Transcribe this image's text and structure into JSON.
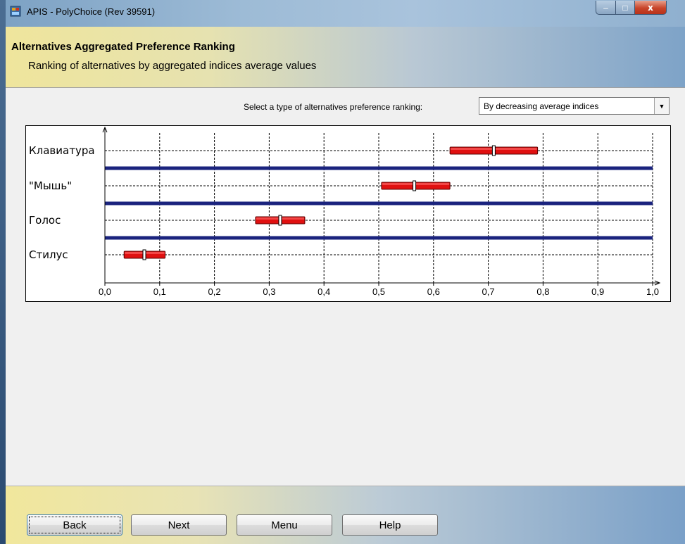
{
  "window": {
    "title": "APIS - PolyChoice (Rev 39591)",
    "controls": {
      "minimize": "–",
      "maximize": "□",
      "close": "x"
    }
  },
  "header": {
    "title": "Alternatives Aggregated Preference Ranking",
    "subtitle": "Ranking of alternatives by aggregated indices average values"
  },
  "ranking": {
    "label": "Select a type of alternatives preference ranking:",
    "selected": "By decreasing average indices"
  },
  "chart_data": {
    "type": "interval",
    "categories": [
      "Клавиатура",
      "\"Мышь\"",
      "Голос",
      "Стилус"
    ],
    "intervals": [
      {
        "low": 0.63,
        "mean": 0.71,
        "high": 0.79
      },
      {
        "low": 0.505,
        "mean": 0.565,
        "high": 0.63
      },
      {
        "low": 0.275,
        "mean": 0.32,
        "high": 0.365
      },
      {
        "low": 0.035,
        "mean": 0.072,
        "high": 0.11
      }
    ],
    "x_ticks": [
      "0,0",
      "0,1",
      "0,2",
      "0,3",
      "0,4",
      "0,5",
      "0,6",
      "0,7",
      "0,8",
      "0,9",
      "1,0"
    ],
    "xlim": [
      0,
      1
    ],
    "grid": true,
    "separators": true,
    "colors": {
      "bar": "#e01010",
      "separator": "#1a237e",
      "grid": "#000000"
    }
  },
  "footer": {
    "back": "Back",
    "next": "Next",
    "menu": "Menu",
    "help": "Help"
  }
}
